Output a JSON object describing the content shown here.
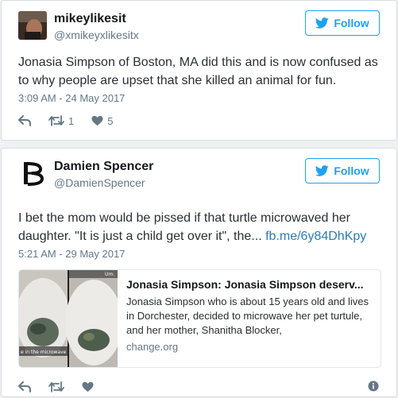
{
  "tweets": [
    {
      "name": "mikeylikesit",
      "handle": "@xmikeyxlikesitx",
      "follow_label": "Follow",
      "text": "Jonasia Simpson of Boston, MA did this and is now confused as to why people are upset that she killed an animal for fun.",
      "timestamp": "3:09 AM - 24 May 2017",
      "retweets": "1",
      "likes": "5",
      "icons": [
        "reply-icon",
        "retweet-icon",
        "heart-icon"
      ]
    },
    {
      "name": "Damien Spencer",
      "handle": "@DamienSpencer",
      "follow_label": "Follow",
      "text": "I bet the mom would be pissed if that turtle microwaved her daughter. \"It is just a child get over it\", the... ",
      "link_text": "fb.me/6y84DhKpy",
      "timestamp": "5:21 AM - 29 May 2017",
      "card": {
        "title": "Jonasia Simpson: Jonasia Simpson deserv...",
        "description": "Jonasia Simpson who is about 15 years old and lives in Dorchester, decided to microwave her pet turtule, and her mother, Shanitha Blocker,",
        "domain": "change.org",
        "image_caption_left": "e in the microwave ..",
        "image_caption_right": "Um."
      },
      "icons": [
        "reply-icon",
        "retweet-icon",
        "heart-icon",
        "info-icon"
      ]
    }
  ],
  "colors": {
    "accent": "#1da1f2",
    "link": "#2b7bb9",
    "muted": "#657786",
    "background": "#eef0f2"
  }
}
